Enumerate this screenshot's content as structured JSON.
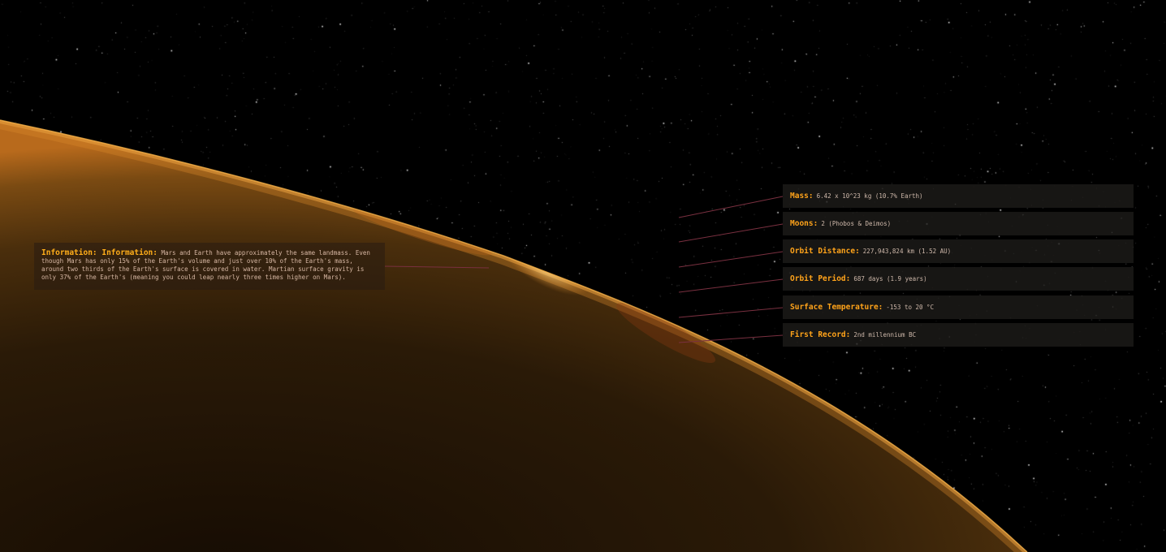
{
  "info": {
    "title": "Information: Information:",
    "text": "Mars and Earth have approximately the same landmass. Even though Mars has only 15% of the Earth's volume and just over 10% of the Earth's mass, around two thirds of the Earth's surface is covered in water. Martian surface gravity is only 37% of the Earth's (meaning you could leap nearly three times higher on Mars)."
  },
  "stats": [
    {
      "label": "Mass:",
      "value": "6.42 x 10^23 kg (10.7% Earth)"
    },
    {
      "label": "Moons:",
      "value": "2 (Phobos & Deimos)"
    },
    {
      "label": "Orbit Distance:",
      "value": "227,943,824 km (1.52 AU)"
    },
    {
      "label": "Orbit Period:",
      "value": "687 days (1.9 years)"
    },
    {
      "label": "Surface Temperature:",
      "value": "-153 to 20 °C"
    },
    {
      "label": "First Record:",
      "value": "2nd millennium BC"
    }
  ],
  "colors": {
    "accent": "#ffa31a",
    "text": "#cfb9ab",
    "connector": "#7a3040",
    "planet_rim": "#f2a43a",
    "planet_body": "#2a1a08",
    "space": "#000000"
  }
}
